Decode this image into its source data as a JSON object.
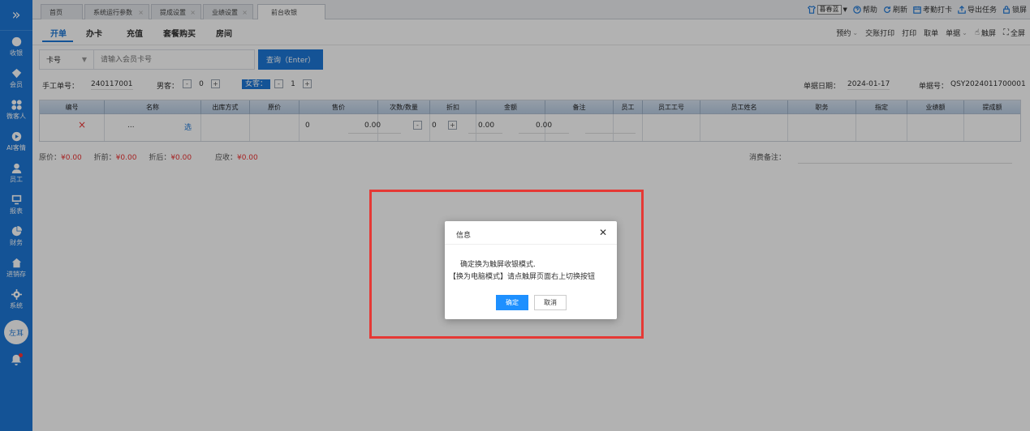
{
  "sidebar": {
    "toggle": "»",
    "items": [
      {
        "label": "收银",
        "icon": "cashier-icon"
      },
      {
        "label": "会员",
        "icon": "member-icon"
      },
      {
        "label": "微客人",
        "icon": "wechat-guest-icon"
      },
      {
        "label": "AI客情",
        "icon": "ai-icon"
      },
      {
        "label": "员工",
        "icon": "staff-icon"
      },
      {
        "label": "报表",
        "icon": "report-icon"
      },
      {
        "label": "财务",
        "icon": "finance-icon"
      },
      {
        "label": "进销存",
        "icon": "inventory-icon"
      },
      {
        "label": "系统",
        "icon": "system-icon"
      }
    ],
    "user_badge": "左耳"
  },
  "tabs": [
    {
      "label": "首页"
    },
    {
      "label": "系统运行参数"
    },
    {
      "label": "提成设置"
    },
    {
      "label": "业绩设置"
    },
    {
      "label": "前台收银"
    }
  ],
  "topbar": {
    "theme": "暮春蓝",
    "help": "帮助",
    "refresh": "刷新",
    "attendance": "考勤打卡",
    "export_tasks": "导出任务",
    "lock": "锁屏"
  },
  "subtabs": [
    "开单",
    "办卡",
    "充值",
    "套餐购买",
    "房间"
  ],
  "right_tools": {
    "reservation": "预约",
    "shift_print": "交账打印",
    "print": "打印",
    "take_order": "取单",
    "documents": "单据",
    "touch": "触屏",
    "fullscreen": "全屏"
  },
  "search": {
    "type": "卡号",
    "placeholder": "请输入会员卡号",
    "button": "查询（Enter）"
  },
  "order_info": {
    "manual_no_label": "手工单号：",
    "manual_no": "240117001",
    "male_label": "男客：",
    "male_count": "0",
    "female_label": "女客：",
    "female_count": "1",
    "date_label": "单据日期：",
    "date": "2024-01-17",
    "doc_no_label": "单据号：",
    "doc_no": "QSY2024011700001"
  },
  "grid": {
    "headers": [
      "编号",
      "名称",
      "出库方式",
      "原价",
      "售价",
      "次数/数量",
      "折扣",
      "金额",
      "备注",
      "员工",
      "员工工号",
      "员工姓名",
      "职务",
      "指定",
      "业绩额",
      "提成额"
    ],
    "row": {
      "delete": "×",
      "more": "...",
      "name": "选",
      "original_price": "0",
      "sale_price": "0.00",
      "qty": "0",
      "discount": "0.00",
      "amount": "0.00"
    }
  },
  "summary": {
    "original_label": "原价：",
    "original": "¥0.00",
    "pre_discount_label": "折前：",
    "pre_discount": "¥0.00",
    "post_discount_label": "折后：",
    "post_discount": "¥0.00",
    "receivable_label": "应收：",
    "receivable": "¥0.00",
    "memo_label": "消费备注："
  },
  "dialog": {
    "title": "信息",
    "line1": "确定换为触屏收银模式.",
    "line2": "【换为电脑模式】请点触屏页面右上切换按钮",
    "ok": "确定",
    "cancel": "取消"
  },
  "colors": {
    "primary": "#1e78d7",
    "highlight_border": "#e53935",
    "price_text": "#e33333"
  }
}
